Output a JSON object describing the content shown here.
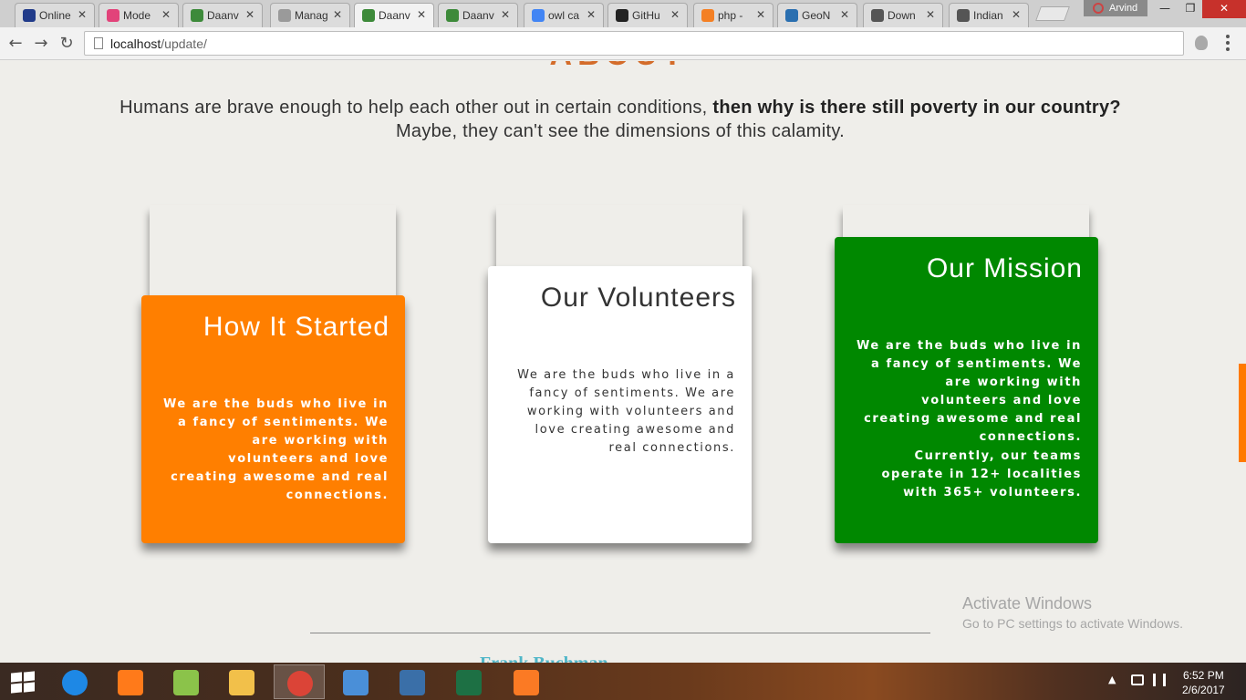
{
  "browser": {
    "tabs": [
      {
        "title": "Online",
        "fav_color": "#213b8a"
      },
      {
        "title": "Mode",
        "fav_color": "#e2437a"
      },
      {
        "title": "Daanv",
        "fav_color": "#3d8a3a"
      },
      {
        "title": "Manag",
        "fav_color": "#9a9a9a"
      },
      {
        "title": "Daanv",
        "fav_color": "#3d8a3a"
      },
      {
        "title": "Daanv",
        "fav_color": "#3d8a3a"
      },
      {
        "title": "owl ca",
        "fav_color": "#4285f4"
      },
      {
        "title": "GitHu",
        "fav_color": "#222222"
      },
      {
        "title": "php -",
        "fav_color": "#f48024"
      },
      {
        "title": "GeoN",
        "fav_color": "#2a6fb0"
      },
      {
        "title": "Down",
        "fav_color": "#555555"
      },
      {
        "title": "Indian",
        "fav_color": "#555555"
      }
    ],
    "close_glyph": "✕",
    "user_name": "Arvind",
    "window_buttons": [
      "—",
      "❐",
      "✕"
    ],
    "back_glyph": "←",
    "forward_glyph": "→",
    "reload_glyph": "↻",
    "url_host": "localhost",
    "url_path": "/update/"
  },
  "page": {
    "heading": "ABOUT",
    "intro_part1": "Humans are brave enough to help each other out in certain conditions, ",
    "intro_bold": "then why is there still poverty in our country?",
    "intro_part2": "Maybe, they can't see the dimensions of this calamity.",
    "cards": [
      {
        "title": "How It Started",
        "body": "We are the buds who live in a fancy of sentiments. We are working with volunteers and love creating awesome and real connections.",
        "body2": "",
        "color": "#ff7f00"
      },
      {
        "title": "Our Volunteers",
        "body": "We are the buds who live in a fancy of sentiments. We are working with volunteers and love creating awesome and real connections.",
        "body2": "",
        "color": "#ffffff"
      },
      {
        "title": "Our Mission",
        "body": "We are the buds who live in a fancy of sentiments. We are working with volunteers and love creating awesome and real connections.",
        "body2": "Currently, our teams operate in 12+ localities with 365+ volunteers.",
        "color": "#008800"
      }
    ],
    "name_peek": "Frank Buchman",
    "scroll_accent": "#ff7a00"
  },
  "os": {
    "activate_title": "Activate Windows",
    "activate_sub": "Go to PC settings to activate Windows.",
    "taskbar_icons": [
      {
        "name": "ie-icon",
        "color": "#1e88e5"
      },
      {
        "name": "uc-browser-icon",
        "color": "#ff7a1a"
      },
      {
        "name": "notepad-chart-icon",
        "color": "#8bc34a"
      },
      {
        "name": "file-explorer-icon",
        "color": "#f2c04a"
      },
      {
        "name": "chrome-icon",
        "color": "#db4437"
      },
      {
        "name": "control-panel-icon",
        "color": "#4a8fd8"
      },
      {
        "name": "wifi-tool-icon",
        "color": "#3a6fa8"
      },
      {
        "name": "excel-icon",
        "color": "#1d7044"
      },
      {
        "name": "xampp-icon",
        "color": "#fb7a24"
      }
    ],
    "tray_glyph": "▲",
    "time": "6:52 PM",
    "date": "2/6/2017"
  }
}
